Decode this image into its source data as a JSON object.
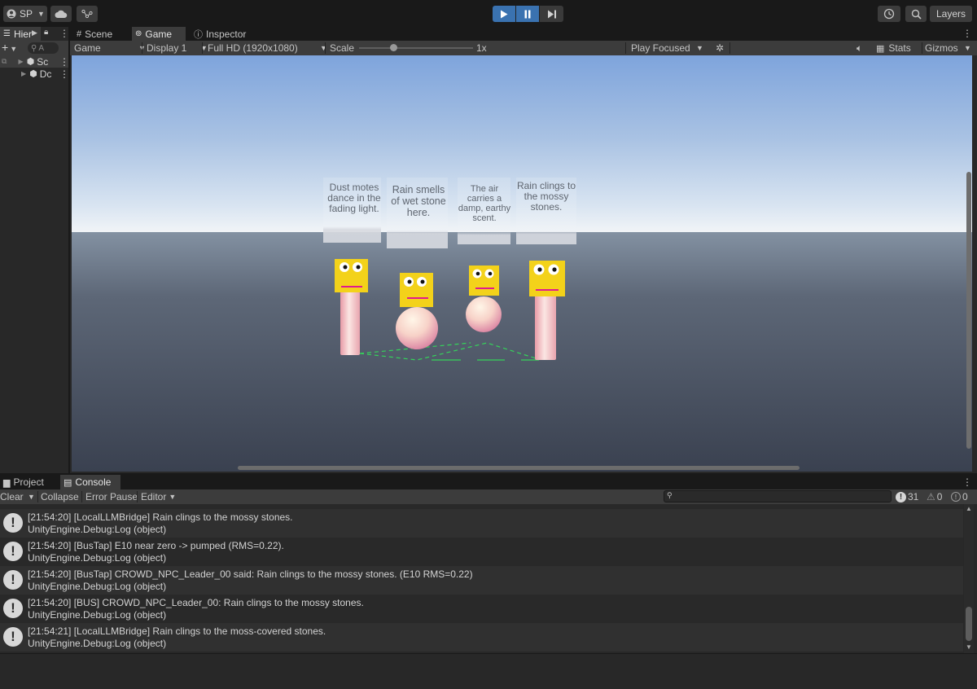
{
  "toolbar": {
    "account_label": "SP",
    "layers_label": "Layers"
  },
  "hierarchy": {
    "tab_label": "Hier",
    "search_placeholder": "A",
    "items": [
      {
        "label": "Sc"
      },
      {
        "label": "Dc"
      }
    ]
  },
  "tabs": {
    "scene": "Scene",
    "game": "Game",
    "inspector": "Inspector"
  },
  "game_toolbar": {
    "view_mode": "Game",
    "display": "Display 1",
    "resolution": "Full HD (1920x1080)",
    "scale_label": "Scale",
    "scale_value": "1x",
    "play_mode": "Play Focused",
    "stats_label": "Stats",
    "gizmos_label": "Gizmos"
  },
  "scene": {
    "bubbles": [
      {
        "text": "Dust motes dance in the fading light."
      },
      {
        "text": "Rain smells of wet stone here."
      },
      {
        "text": "The air carries a damp, earthy scent."
      },
      {
        "text": "Rain clings to the mossy stones."
      }
    ]
  },
  "console": {
    "tabs": {
      "project": "Project",
      "console": "Console"
    },
    "toolbar": {
      "clear": "Clear",
      "collapse": "Collapse",
      "error_pause": "Error Pause",
      "editor": "Editor"
    },
    "counts": {
      "logs": "31",
      "warnings": "0",
      "errors": "0"
    },
    "entries": [
      {
        "line1": "[21:54:20] [LocalLLMBridge] Rain clings to the mossy stones.",
        "line2": "UnityEngine.Debug:Log (object)"
      },
      {
        "line1": "[21:54:20] [BusTap] E10 near zero -> pumped (RMS=0.22).",
        "line2": "UnityEngine.Debug:Log (object)"
      },
      {
        "line1": "[21:54:20] [BusTap] CROWD_NPC_Leader_00 said: Rain clings to the mossy stones. (E10 RMS=0.22)",
        "line2": "UnityEngine.Debug:Log (object)"
      },
      {
        "line1": "[21:54:20] [BUS] CROWD_NPC_Leader_00: Rain clings to the mossy stones.",
        "line2": "UnityEngine.Debug:Log (object)"
      },
      {
        "line1": "[21:54:21] [LocalLLMBridge] Rain clings to the moss-covered stones.",
        "line2": "UnityEngine.Debug:Log (object)"
      }
    ]
  }
}
